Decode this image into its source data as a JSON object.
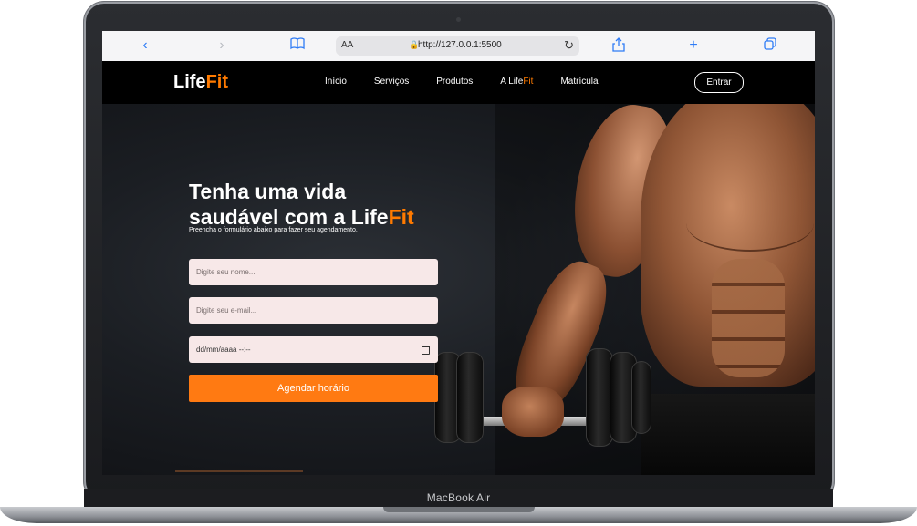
{
  "device": {
    "label": "MacBook Air"
  },
  "browser": {
    "address_small_text": "AA",
    "url": "http://127.0.0.1:5500",
    "icons": {
      "back": "chevron-left-icon",
      "forward": "chevron-right-icon",
      "bookmarks": "book-icon",
      "share": "share-icon",
      "new_tab": "plus-icon",
      "tabs": "tabs-icon",
      "reload": "reload-icon",
      "lock": "lock-icon"
    }
  },
  "site": {
    "logo": {
      "part1": "Life",
      "part2": "Fit"
    },
    "nav": {
      "items": [
        {
          "label": "Início"
        },
        {
          "label": "Serviços"
        },
        {
          "label": "Produtos"
        }
      ],
      "about": {
        "part1": "A Life",
        "part2": "Fit"
      },
      "enroll": "Matrícula",
      "login_button": "Entrar"
    },
    "hero": {
      "headline_line1": "Tenha uma vida",
      "headline_line2_part1": "saudável com a Life",
      "headline_line2_part2": "Fit",
      "subheadline": "Preencha o formulário abaixo para fazer seu agendamento.",
      "form": {
        "name_placeholder": "Digite seu nome...",
        "email_placeholder": "Digite seu e-mail...",
        "date_value": "dd/mm/aaaa  --:--",
        "submit_label": "Agendar horário"
      }
    }
  },
  "colors": {
    "accent": "#ff7a00",
    "button": "#ff7a12",
    "input_bg": "#f7e8e8",
    "nav_bg": "#000000",
    "browser_link": "#2f7cf6"
  }
}
